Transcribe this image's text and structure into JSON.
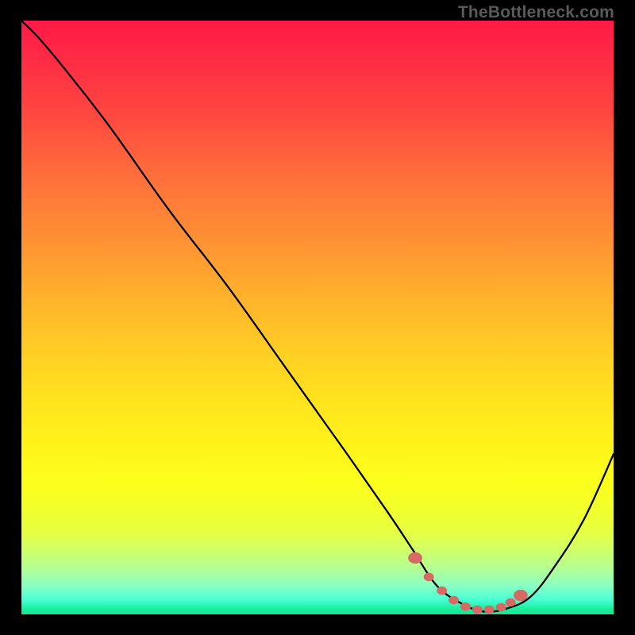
{
  "watermark": "TheBottleneck.com",
  "colors": {
    "background": "#000000",
    "curve_stroke": "#000000",
    "marker_fill": "#d86a66",
    "watermark_text": "#5a5a5a"
  },
  "chart_data": {
    "type": "line",
    "title": "",
    "xlabel": "",
    "ylabel": "",
    "xlim": [
      0,
      100
    ],
    "ylim": [
      0,
      100
    ],
    "grid": false,
    "series": [
      {
        "name": "bottleneck-curve",
        "x": [
          0,
          3,
          8,
          15,
          25,
          35,
          45,
          55,
          62,
          66,
          70,
          74,
          78,
          82,
          86,
          90,
          95,
          100
        ],
        "y": [
          100,
          97,
          91,
          82,
          68,
          55,
          41,
          27,
          17,
          11,
          5,
          2,
          0.5,
          1,
          3,
          8,
          16,
          27
        ]
      }
    ],
    "markers": {
      "name": "optimal-range",
      "x": [
        66.5,
        68.8,
        71,
        73,
        75,
        77,
        79,
        81,
        82.6,
        84.3
      ],
      "y": [
        9.5,
        6.3,
        4,
        2.4,
        1.3,
        0.8,
        0.8,
        1.2,
        2,
        3.2
      ]
    },
    "gradient_bands": [
      {
        "pos": 0.0,
        "color": "#ff1a45"
      },
      {
        "pos": 0.26,
        "color": "#ff6e3c"
      },
      {
        "pos": 0.56,
        "color": "#ffcf24"
      },
      {
        "pos": 0.78,
        "color": "#fcff1c"
      },
      {
        "pos": 0.92,
        "color": "#b6ff90"
      },
      {
        "pos": 1.0,
        "color": "#15e58e"
      }
    ]
  }
}
